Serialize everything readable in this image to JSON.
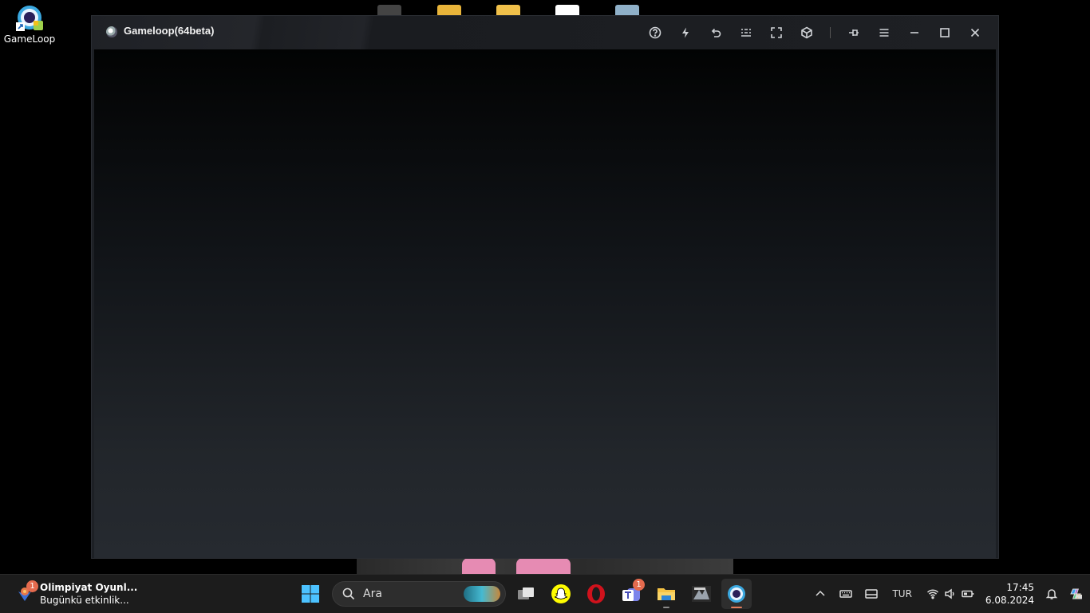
{
  "desktop": {
    "icons": [
      {
        "label": "GameLoop"
      }
    ]
  },
  "window": {
    "title": "Gameloop(64beta)",
    "controls": [
      {
        "icon": "help-icon"
      },
      {
        "icon": "lightning-icon"
      },
      {
        "icon": "undo-icon"
      },
      {
        "icon": "keyboard-grid-icon"
      },
      {
        "icon": "fullscreen-icon"
      },
      {
        "icon": "cube-icon"
      },
      {
        "icon": "pin-icon"
      },
      {
        "icon": "menu-icon"
      },
      {
        "icon": "minimize-icon"
      },
      {
        "icon": "maximize-icon"
      },
      {
        "icon": "close-icon"
      }
    ]
  },
  "taskbar": {
    "widget": {
      "title": "Olimpiyat Oyunl...",
      "subtitle": "Bugünkü etkinlik...",
      "badge": "1"
    },
    "search": {
      "placeholder": "Ara"
    },
    "apps": [
      {
        "name": "task-view"
      },
      {
        "name": "snapchat"
      },
      {
        "name": "opera"
      },
      {
        "name": "teams",
        "badge": "1"
      },
      {
        "name": "file-explorer"
      },
      {
        "name": "game"
      },
      {
        "name": "gameloop"
      }
    ],
    "tray": {
      "language": "TUR",
      "time": "17:45",
      "date": "6.08.2024"
    }
  }
}
